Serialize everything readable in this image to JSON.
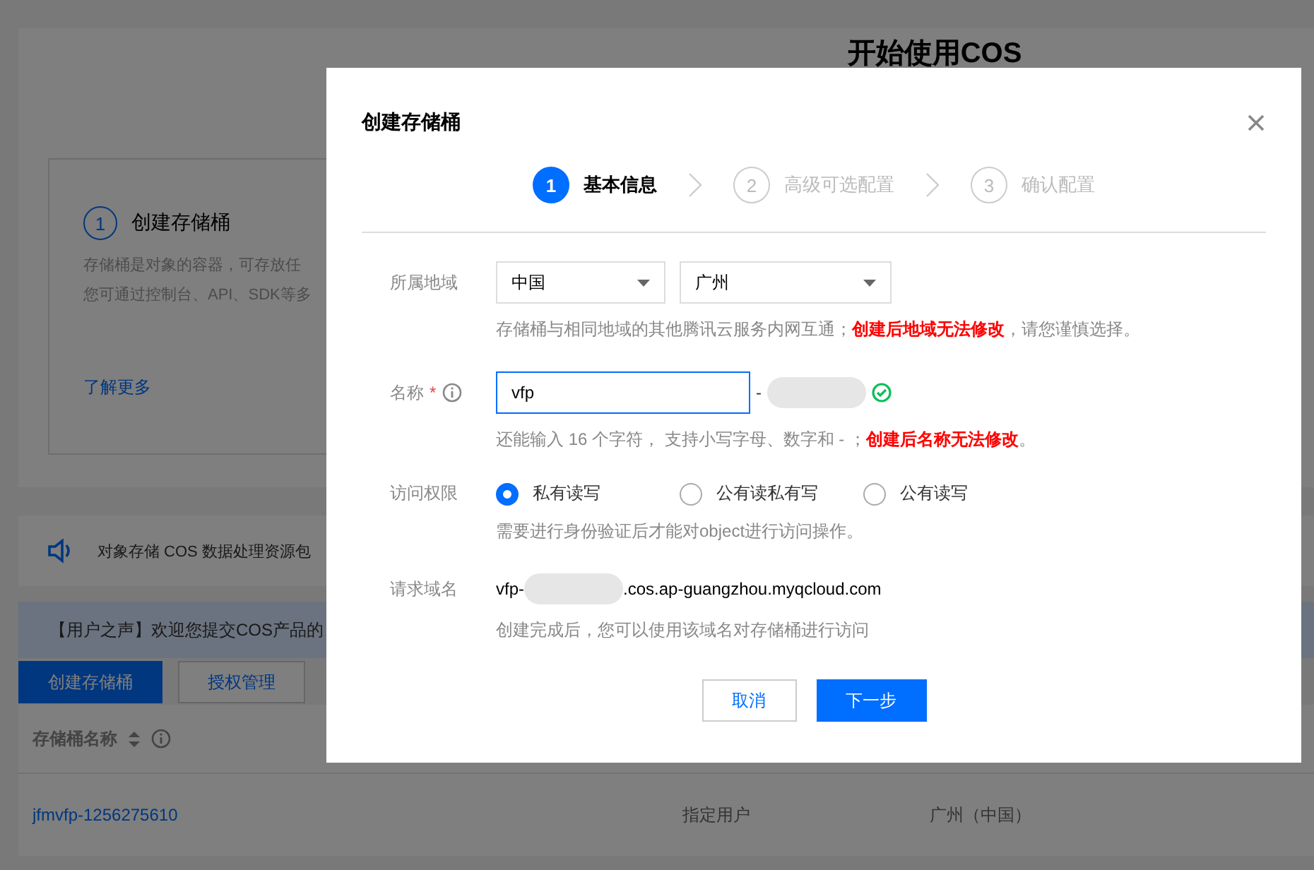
{
  "background": {
    "heading": "开始使用COS",
    "card": {
      "step": "1",
      "title": "创建存储桶",
      "lines": [
        "存储桶是对象的容器，可存放任",
        "您可通过控制台、API、SDK等多"
      ],
      "link": "了解更多"
    },
    "notice": "对象存储 COS 数据处理资源包",
    "banner": "【用户之声】欢迎您提交COS产品的",
    "buttons": [
      {
        "label": "创建存储桶",
        "primary": true
      },
      {
        "label": "授权管理",
        "primary": false
      }
    ],
    "table": {
      "columns": [
        "存储桶名称"
      ],
      "rows": [
        {
          "cells": [
            "jfmvfp-1256275610",
            "指定用户",
            "广州（中国）"
          ]
        }
      ]
    }
  },
  "dialog": {
    "title": "创建存储桶",
    "steps": [
      {
        "number": "1",
        "label": "基本信息",
        "selected": true
      },
      {
        "number": "2",
        "label": "高级可选配置",
        "selected": false
      },
      {
        "number": "3",
        "label": "确认配置",
        "selected": false
      }
    ],
    "fields": [
      {
        "kind": "selects",
        "label": "所属地域",
        "selects": [
          "中国",
          "广州"
        ],
        "hint": "存储桶与相同地域的其他腾讯云服务内网互通；**创建后地域无法修改**，请您谨慎选择。"
      },
      {
        "kind": "input",
        "label": "名称",
        "mark": "*",
        "value": "vfp",
        "suffix": "-",
        "valid": true,
        "hint": "还能输入 16 个字符， 支持小写字母、数字和 - ；**创建后名称无法修改**。"
      },
      {
        "kind": "radios",
        "label": "访问权限",
        "options": [
          {
            "label": "私有读写",
            "selected": true
          },
          {
            "label": "公有读私有写",
            "selected": false
          },
          {
            "label": "公有读写",
            "selected": false
          }
        ],
        "hint": "需要进行身份验证后才能对object进行访问操作。"
      },
      {
        "kind": "text",
        "label": "请求域名",
        "prefix": "vfp-",
        "suffix": ".cos.ap-guangzhou.myqcloud.com",
        "hint": "创建完成后，您可以使用该域名对存储桶进行访问"
      }
    ],
    "buttons": [
      {
        "label": "取消",
        "primary": false
      },
      {
        "label": "下一步",
        "primary": true
      }
    ]
  }
}
